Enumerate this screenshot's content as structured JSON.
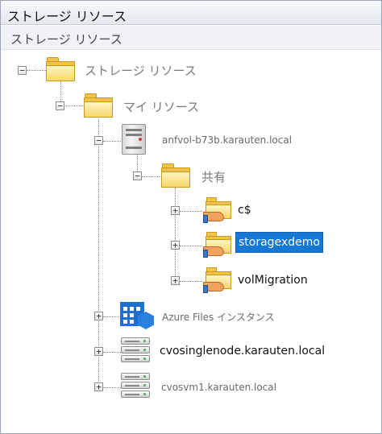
{
  "window": {
    "title": "ストレージ リソース",
    "subtitle": "ストレージ リソース"
  },
  "tree": {
    "root": {
      "label": "ストレージ リソース",
      "icon": "folder-icon",
      "toggle": "−"
    },
    "my_resources": {
      "label": "マイ リソース",
      "icon": "folder-icon",
      "toggle": "−"
    },
    "server1": {
      "label": "anfvol-b73b.karauten.local",
      "icon": "server-tower-icon",
      "toggle": "−"
    },
    "shares": {
      "label": "共有",
      "icon": "folder-icon",
      "toggle": "−"
    },
    "share_c": {
      "label": "c$",
      "icon": "shared-folder-icon",
      "toggle": "+"
    },
    "share_storagex": {
      "label": "storagexdemo",
      "icon": "shared-folder-icon",
      "toggle": "+",
      "selected": true
    },
    "share_vol": {
      "label": "volMigration",
      "icon": "shared-folder-icon",
      "toggle": "+"
    },
    "azure": {
      "label": "Azure Files インスタンス",
      "icon": "azure-files-icon",
      "toggle": "+"
    },
    "server2": {
      "label": "cvosinglenode.karauten.local",
      "icon": "server-rack-icon",
      "toggle": "+"
    },
    "server3": {
      "label": "cvosvm1.karauten.local",
      "icon": "server-rack-icon",
      "toggle": "+"
    }
  },
  "colors": {
    "selection": "#1478d4",
    "azure": "#1f6fcf",
    "folder": "#f1c24a"
  }
}
